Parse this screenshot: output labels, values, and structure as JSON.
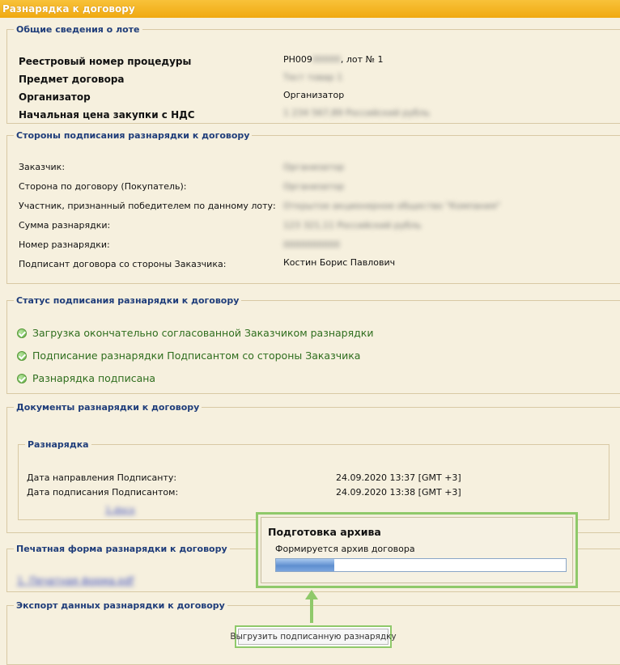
{
  "window": {
    "title": "Разнарядка к договору"
  },
  "lot_info": {
    "legend": "Общие сведения о лоте",
    "rows": [
      {
        "label": "Реестровый номер процедуры",
        "value": "РН009",
        "value_hidden": "00000",
        "value_suffix": ", лот № 1"
      },
      {
        "label": "Предмет договора",
        "value": "Тест товар 1"
      },
      {
        "label": "Организатор",
        "value": "Организатор"
      },
      {
        "label": "Начальная цена закупки с НДС",
        "value": "1 234 567,89 Российский рубль"
      }
    ]
  },
  "parties": {
    "legend": "Стороны подписания разнарядки к договору",
    "rows": [
      {
        "label": "Заказчик:",
        "value": "Организатор"
      },
      {
        "label": "Сторона по договору (Покупатель):",
        "value": "Организатор"
      },
      {
        "label": "Участник, признанный победителем по данному лоту:",
        "value": "Открытое акционерное общество \"Компания\""
      },
      {
        "label": "Сумма разнарядки:",
        "value": "123 321,11 Российский рубль"
      },
      {
        "label": "Номер разнарядки:",
        "value": "0000000000"
      },
      {
        "label": "Подписант договора со стороны Заказчика:",
        "value": "Костин Борис Павлович"
      }
    ]
  },
  "status": {
    "legend": "Статус подписания разнарядки к договору",
    "items": [
      "Загрузка окончательно согласованной Заказчиком разнарядки",
      "Подписание разнарядки Подписантом со стороны Заказчика",
      "Разнарядка подписана"
    ]
  },
  "documents": {
    "legend": "Документы разнарядки к договору",
    "group_legend": "Разнарядка",
    "rows": [
      {
        "label": "Дата направления Подписанту:",
        "value": "24.09.2020 13:37 [GMT +3]"
      },
      {
        "label": "Дата подписания Подписантом:",
        "value": "24.09.2020 13:38 [GMT +3]"
      }
    ],
    "file_link": "1.docx"
  },
  "print_form": {
    "legend": "Печатная форма разнарядки к договору",
    "link": "1. Печатная форма.pdf"
  },
  "export": {
    "legend": "Экспорт данных разнарядки к договору",
    "button": "Выгрузить подписанную разнарядку"
  },
  "archive_dialog": {
    "title": "Подготовка архива",
    "message": "Формируется архив договора",
    "progress": 0.2
  },
  "colors": {
    "titlebar": "#f0a910",
    "legend_text": "#1f3d7a",
    "status_text": "#2f6e1e",
    "highlight": "#8fc96a"
  }
}
